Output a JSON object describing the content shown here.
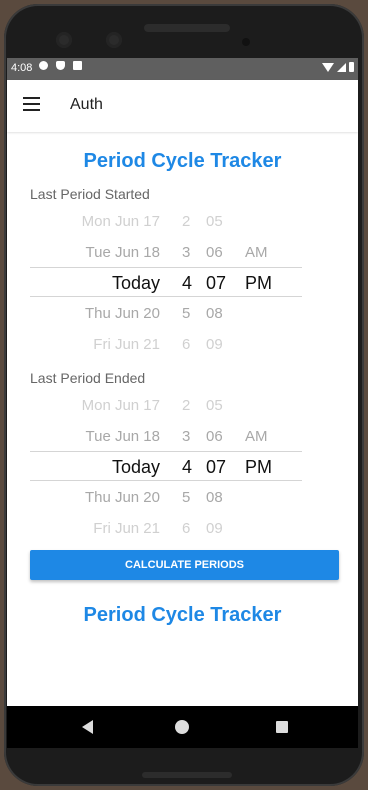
{
  "statusbar": {
    "time": "4:08"
  },
  "appbar": {
    "title": "Auth"
  },
  "tracker": {
    "heading": "Period Cycle Tracker",
    "started_label": "Last Period Started",
    "ended_label": "Last Period Ended",
    "button_label": "CALCULATE PERIODS",
    "footer_heading": "Period Cycle Tracker"
  },
  "picker_started": {
    "rows": [
      {
        "date": "Mon Jun 17",
        "hour": "2",
        "minute": "05",
        "ampm": ""
      },
      {
        "date": "Tue Jun 18",
        "hour": "3",
        "minute": "06",
        "ampm": "AM"
      },
      {
        "date": "Today",
        "hour": "4",
        "minute": "07",
        "ampm": "PM"
      },
      {
        "date": "Thu Jun 20",
        "hour": "5",
        "minute": "08",
        "ampm": ""
      },
      {
        "date": "Fri Jun 21",
        "hour": "6",
        "minute": "09",
        "ampm": ""
      }
    ]
  },
  "picker_ended": {
    "rows": [
      {
        "date": "Mon Jun 17",
        "hour": "2",
        "minute": "05",
        "ampm": ""
      },
      {
        "date": "Tue Jun 18",
        "hour": "3",
        "minute": "06",
        "ampm": "AM"
      },
      {
        "date": "Today",
        "hour": "4",
        "minute": "07",
        "ampm": "PM"
      },
      {
        "date": "Thu Jun 20",
        "hour": "5",
        "minute": "08",
        "ampm": ""
      },
      {
        "date": "Fri Jun 21",
        "hour": "6",
        "minute": "09",
        "ampm": ""
      }
    ]
  },
  "colors": {
    "accent": "#1e88e5"
  }
}
